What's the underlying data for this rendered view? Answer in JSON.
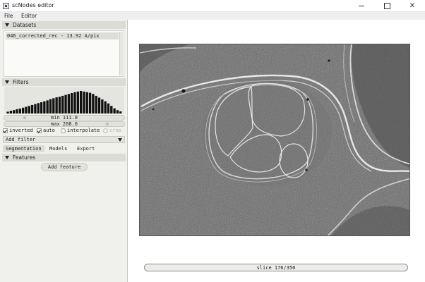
{
  "window": {
    "title": "scNodes editor"
  },
  "menu": {
    "items": [
      "File",
      "Editor"
    ]
  },
  "datasets": {
    "header": "Datasets",
    "items": [
      "046_corrected_rec - 13.92 A/pix"
    ]
  },
  "filters": {
    "header": "Filters",
    "histogram": [
      6,
      9,
      11,
      14,
      16,
      19,
      22,
      25,
      28,
      31,
      34,
      37,
      40,
      43,
      47,
      50,
      53,
      55,
      58,
      61,
      64,
      67,
      70,
      72,
      74,
      72,
      70,
      68,
      64,
      58,
      52,
      46,
      40,
      33,
      25,
      17,
      11,
      7
    ],
    "min_label": "min 111.0",
    "max_label": "max 208.0",
    "min_level": 0.17,
    "max_level": 0.85,
    "options": {
      "inverted": {
        "label": "inverted",
        "checked": true
      },
      "auto": {
        "label": "auto",
        "checked": true
      },
      "interpolate": {
        "label": "interpolate",
        "checked": false
      },
      "crop": {
        "label": "crop",
        "checked": false,
        "disabled": true
      }
    },
    "add_filter_label": "Add filter"
  },
  "tabs": [
    "Segmentation",
    "Models",
    "Export"
  ],
  "features": {
    "header": "Features",
    "add_feature_label": "Add feature"
  },
  "viewer": {
    "slice_label": "slice 176/350",
    "slice_current": 176,
    "slice_total": 350
  }
}
